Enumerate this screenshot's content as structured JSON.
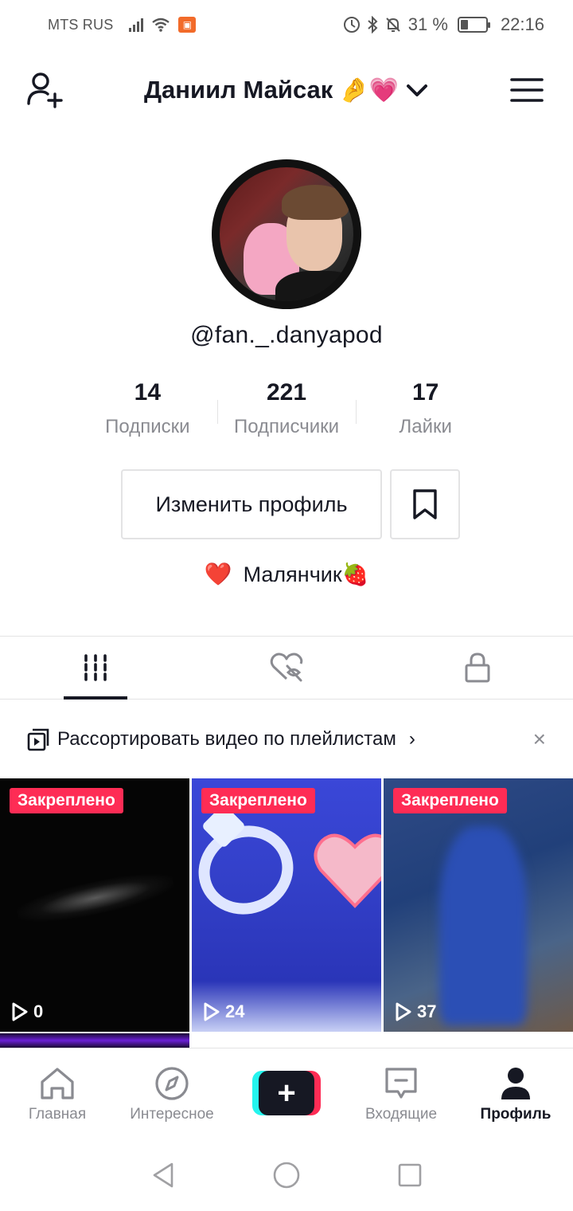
{
  "status_bar": {
    "carrier": "MTS RUS",
    "battery_percent": "31 %",
    "battery_level": 0.31,
    "time": "22:16"
  },
  "header": {
    "title": "Даниил Майсак",
    "title_emoji": "🤌💗"
  },
  "profile": {
    "username": "@fan._.danyapod",
    "stats": [
      {
        "value": "14",
        "label": "Подписки"
      },
      {
        "value": "221",
        "label": "Подписчики"
      },
      {
        "value": "17",
        "label": "Лайки"
      }
    ],
    "edit_button": "Изменить профиль",
    "bio_heart": "❤️",
    "bio": "Малянчик🍓"
  },
  "banner": {
    "text": "Рассортировать видео по плейлистам",
    "chevron": "›",
    "close": "×"
  },
  "videos": [
    {
      "badge": "Закреплено",
      "views": "0"
    },
    {
      "badge": "Закреплено",
      "views": "24"
    },
    {
      "badge": "Закреплено",
      "views": "37"
    }
  ],
  "bottom_nav": {
    "items": [
      {
        "label": "Главная"
      },
      {
        "label": "Интересное"
      },
      {
        "label": "+"
      },
      {
        "label": "Входящие"
      },
      {
        "label": "Профиль"
      }
    ]
  },
  "colors": {
    "accent": "#fe2c55",
    "cyan": "#25f4ee",
    "text": "#161823",
    "muted": "#8a8b91"
  }
}
